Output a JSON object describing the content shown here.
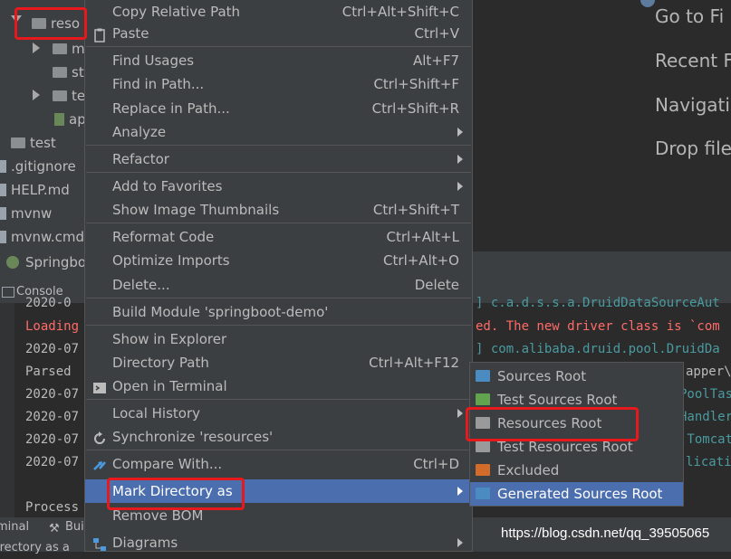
{
  "tree": {
    "items": [
      {
        "label": "reso",
        "icon": "folder-icon"
      },
      {
        "label": "m",
        "icon": "folder-icon"
      },
      {
        "label": "st",
        "icon": "folder-icon"
      },
      {
        "label": "te",
        "icon": "folder-icon"
      },
      {
        "label": "ap",
        "icon": "properties-file-icon"
      },
      {
        "label": "test",
        "icon": "folder-icon"
      },
      {
        "label": ".gitignore",
        "icon": "file-icon"
      },
      {
        "label": "HELP.md",
        "icon": "file-icon"
      },
      {
        "label": "mvnw",
        "icon": "file-icon"
      },
      {
        "label": "mvnw.cmd",
        "icon": "file-icon"
      }
    ]
  },
  "run_tab": {
    "label": "Springbo"
  },
  "console_tab": {
    "label": "Console"
  },
  "welcome": {
    "items": [
      "Go to Fi",
      "Recent Fi",
      "Navigatio",
      "Drop file"
    ]
  },
  "console": {
    "lines": [
      {
        "left": "2020-0",
        "right": "] c.a.d.s.s.a.DruidDataSourceAut"
      },
      {
        "left": "Loading",
        "right": "ed. The new driver class is `com"
      },
      {
        "left": "2020-07",
        "right": "] com.alibaba.druid.pool.DruidDa"
      },
      {
        "left": "Parsed",
        "right": "apper\\U"
      },
      {
        "left": "2020-07",
        "right": "PoolTas"
      },
      {
        "left": "2020-07",
        "right": "Handler"
      },
      {
        "left": "2020-07",
        "right": ".Tomcat"
      },
      {
        "left": "2020-07",
        "right": "licatio"
      },
      {
        "left": "Process",
        "right": ""
      }
    ]
  },
  "bottom_tabs": {
    "terminal": "minal",
    "build": "Bui",
    "status": "irectory as a"
  },
  "menu": {
    "items": [
      {
        "label": "Copy Relative Path",
        "shortcut": "Ctrl+Alt+Shift+C",
        "icon": "",
        "submenu": false
      },
      {
        "label": "Paste",
        "shortcut": "Ctrl+V",
        "icon": "clipboard-icon",
        "submenu": false
      },
      {
        "label": "Find Usages",
        "shortcut": "Alt+F7",
        "icon": "",
        "submenu": false
      },
      {
        "label": "Find in Path...",
        "shortcut": "Ctrl+Shift+F",
        "icon": "",
        "submenu": false
      },
      {
        "label": "Replace in Path...",
        "shortcut": "Ctrl+Shift+R",
        "icon": "",
        "submenu": false
      },
      {
        "label": "Analyze",
        "shortcut": "",
        "icon": "",
        "submenu": true
      },
      {
        "label": "Refactor",
        "shortcut": "",
        "icon": "",
        "submenu": true
      },
      {
        "label": "Add to Favorites",
        "shortcut": "",
        "icon": "",
        "submenu": true
      },
      {
        "label": "Show Image Thumbnails",
        "shortcut": "Ctrl+Shift+T",
        "icon": "",
        "submenu": false
      },
      {
        "label": "Reformat Code",
        "shortcut": "Ctrl+Alt+L",
        "icon": "",
        "submenu": false
      },
      {
        "label": "Optimize Imports",
        "shortcut": "Ctrl+Alt+O",
        "icon": "",
        "submenu": false
      },
      {
        "label": "Delete...",
        "shortcut": "Delete",
        "icon": "",
        "submenu": false
      },
      {
        "label": "Build Module 'springboot-demo'",
        "shortcut": "",
        "icon": "",
        "submenu": false
      },
      {
        "label": "Show in Explorer",
        "shortcut": "",
        "icon": "",
        "submenu": false
      },
      {
        "label": "Directory Path",
        "shortcut": "Ctrl+Alt+F12",
        "icon": "",
        "submenu": false
      },
      {
        "label": "Open in Terminal",
        "shortcut": "",
        "icon": "terminal-icon",
        "submenu": false
      },
      {
        "label": "Local History",
        "shortcut": "",
        "icon": "",
        "submenu": true
      },
      {
        "label": "Synchronize 'resources'",
        "shortcut": "",
        "icon": "sync-icon",
        "submenu": false
      },
      {
        "label": "Compare With...",
        "shortcut": "Ctrl+D",
        "icon": "compare-icon",
        "submenu": false
      },
      {
        "label": "Mark Directory as",
        "shortcut": "",
        "icon": "",
        "submenu": true
      },
      {
        "label": "Remove BOM",
        "shortcut": "",
        "icon": "",
        "submenu": false
      },
      {
        "label": "Diagrams",
        "shortcut": "",
        "icon": "diagram-icon",
        "submenu": true
      }
    ],
    "selected": "Mark Directory as"
  },
  "submenu": {
    "items": [
      {
        "label": "Sources Root",
        "color": "#4a8bc2"
      },
      {
        "label": "Test Sources Root",
        "color": "#62a44e"
      },
      {
        "label": "Resources Root",
        "color": "#9a9a9a"
      },
      {
        "label": "Test Resources Root",
        "color": "#9a9a9a"
      },
      {
        "label": "Excluded",
        "color": "#d36b2b"
      },
      {
        "label": "Generated Sources Root",
        "color": "#4a8bc2"
      }
    ],
    "selected": "Generated Sources Root"
  },
  "watermark": {
    "text": "https://blog.csdn.net/qq_39505065"
  },
  "colors": {
    "highlight": "#e8191c",
    "selection": "#4b6eaf",
    "menu_bg": "#3c3f41"
  }
}
